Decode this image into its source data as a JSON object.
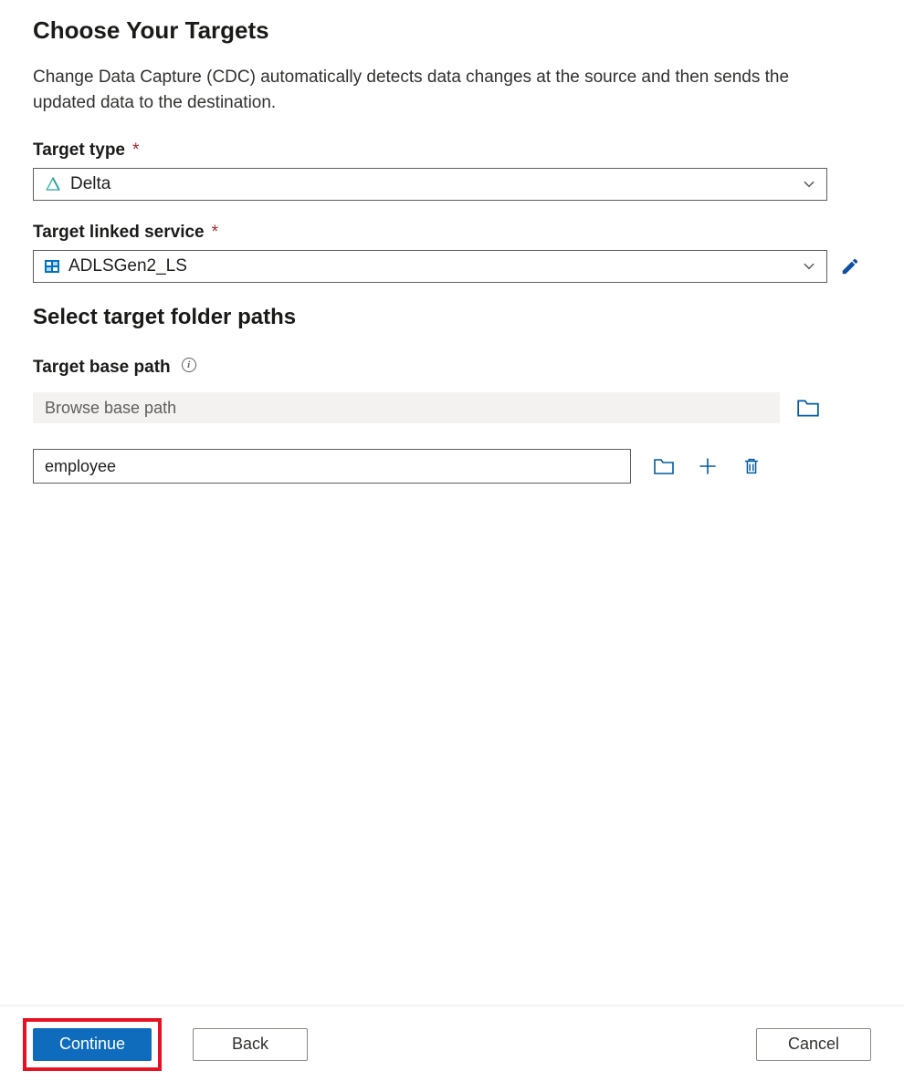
{
  "header": {
    "title": "Choose Your Targets",
    "description": "Change Data Capture (CDC) automatically detects data changes at the source and then sends the updated data to the destination."
  },
  "targetType": {
    "label": "Target type",
    "value": "Delta"
  },
  "targetLinkedService": {
    "label": "Target linked service",
    "value": "ADLSGen2_LS"
  },
  "folderPaths": {
    "sectionTitle": "Select target folder paths",
    "basePathLabel": "Target base path",
    "basePathPlaceholder": "Browse base path",
    "basePathValue": "",
    "pathValue": "employee"
  },
  "footer": {
    "continueLabel": "Continue",
    "backLabel": "Back",
    "cancelLabel": "Cancel"
  },
  "colors": {
    "accent": "#0f6cbd",
    "link": "#005ba1",
    "error": "#e81123",
    "required": "#a4262c"
  }
}
